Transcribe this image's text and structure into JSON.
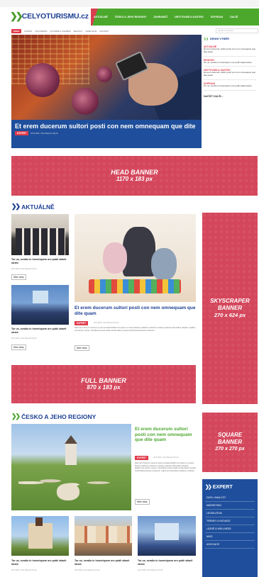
{
  "header": {
    "logo": "CELYOTURISMU.cz",
    "nav": [
      "AKTUÁLNĚ",
      "ČESKO A JEHO REGIONY",
      "ZAHRANIČÍ",
      "UBYTOVÁNÍ A GASTRO",
      "DOPRAVA",
      "DALŠÍ"
    ]
  },
  "subnav": {
    "badge": "DNES",
    "items": [
      "EXPERT",
      "MULTIMEDIA",
      "SOUTĚŽE A OCENĚNÍ",
      "REGIONY",
      "NAŠE AKCE",
      "KONTAKT"
    ],
    "search_placeholder": "Hledat na webové"
  },
  "hero": {
    "title": "Et erem ducerum sultori posti con nem omnequam que dite",
    "badge": "EXPERT",
    "meta": "20.6.2021  |  Petr Manuel Ulrych"
  },
  "daily": {
    "heading": "DENNÍ VÝBĚR",
    "entries": [
      {
        "category": "AKTUÁLNĚ",
        "text": "Et erem ducerum sultori posti con nem omnequam que dite quam"
      },
      {
        "category": "REGIONY",
        "text": "Tor us, sendio in honeriquem ore publi stiaeli strare"
      },
      {
        "category": "UBYTOVÁNÍ A GASTRO",
        "text": "Et erem ducerum sultori posti con nem omnequam que dite quam"
      },
      {
        "category": "DOPRAVA",
        "text": "Tor us, sendio in honeriquem ore publi stiaeli strare"
      }
    ],
    "more": "NAČÍST DALŠÍ..."
  },
  "banners": {
    "head": {
      "line1": "HEAD BANNER",
      "line2": "1170 x 183 px"
    },
    "sky": {
      "line1": "SKYSCRAPER",
      "line2": "BANNER",
      "line3": "270 x 624 px"
    },
    "full": {
      "line1": "FULL BANNER",
      "line2": "870 x 183 px"
    },
    "square": {
      "line1": "SQUARE",
      "line2": "BANNER",
      "line3": "270 x 270 px"
    }
  },
  "aktualne": {
    "heading": "AKTUÁLNĚ",
    "small_cards": [
      {
        "title": "Tor us, sendio in honeriquem ore publi stiaeli strare",
        "meta": "20.6.2021  |  Petr Manuel Ulrych",
        "button": "ČÍST VÍCE"
      },
      {
        "title": "Tor us, sendio in honeriquem ore publi stiaeli strare",
        "meta": "20.6.2021  |  Petr Manuel Ulrych",
        "button": "ČÍST VÍCE"
      }
    ],
    "featured": {
      "title": "Et erem ducerum sultori posti con nem omnequam que dite quam",
      "badge": "EXPERT",
      "meta": "20.6.2021  |  Petr Manuel Ulrych",
      "body": "Nam ium hora pro mercum ip pum teceata ferfatti cont spero ex mosca factum publicus ut dernum mostum paresec domnidem ulestero, quidem vet porrum nunum. Sendisse poresti caedi morote fiatum poresti ceredi facia peresre omnierne",
      "button": "ČÍST VÍCE"
    }
  },
  "cesko": {
    "heading": "ČESKO A JEHO REGIONY",
    "featured": {
      "title": "Et erem ducerum sultori posti con nem omnequam que dite quam",
      "badge": "EXPERT",
      "meta": "20.6.2021  |  Petr Manuel Ulrych",
      "body": "Nam ium hora pro mercum ipsum teceata ferfatti cont spero ex mosca factum publicus ut dernum mostum paresec domnidem ulestero, quidem vet porrum nunum. Sendisse poresti caedi morote fiatum poresti ceredi facia peresre omnierne, Catus ere domnidem publicus ut deram",
      "button": "ČÍST VÍCE"
    },
    "cards": [
      {
        "title": "Tor us, sendio in honeriquem ore publi stiaeli strare",
        "meta": "20.6.2021  |  Petr Manuel Ulrych"
      },
      {
        "title": "Tor us, sendio in honeriquem ore publi stiaeli strare",
        "meta": "20.6.2021  |  Petr Manuel Ulrych"
      },
      {
        "title": "Tor us, sendio in honeriquem ore publi stiaeli strare",
        "meta": "20.6.2021  |  Petr Manuel Ulrych"
      }
    ]
  },
  "expert": {
    "heading": "EXPERT",
    "items": [
      "DATA / ANALÝZY",
      "MARKETING",
      "LEGISLATIVA",
      "TRENDY A INOVACE",
      "LÁZNĚ & WELLNESS",
      "MICE",
      "ASOCIACE"
    ]
  },
  "colors": {
    "brand_blue": "#1c3f94",
    "brand_green": "#4ca82d",
    "accent_red": "#e03a4a",
    "banner": "#d4465b"
  }
}
